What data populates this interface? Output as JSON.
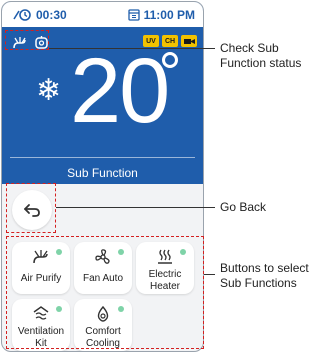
{
  "status_bar": {
    "left_time": "00:30",
    "right_time": "11:00 PM"
  },
  "badges": [
    "UV",
    "CH"
  ],
  "temperature": "20",
  "sub_function_title": "Sub Function",
  "tiles": [
    {
      "label_line1": "Air Purify",
      "label_line2": ""
    },
    {
      "label_line1": "Fan Auto",
      "label_line2": ""
    },
    {
      "label_line1": "Electric",
      "label_line2": "Heater"
    },
    {
      "label_line1": "Ventilation",
      "label_line2": "Kit"
    },
    {
      "label_line1": "Comfort",
      "label_line2": "Cooling"
    }
  ],
  "callouts": {
    "check": {
      "line1": "Check Sub",
      "line2": "Function status"
    },
    "back": "Go Back",
    "select": {
      "line1": "Buttons to select",
      "line2": "Sub Functions"
    }
  },
  "colors": {
    "primary_blue": "#1f5dab",
    "badge_yellow": "#f2c200",
    "status_dot": "#7fd3a8",
    "annotation_red": "#d42020"
  }
}
